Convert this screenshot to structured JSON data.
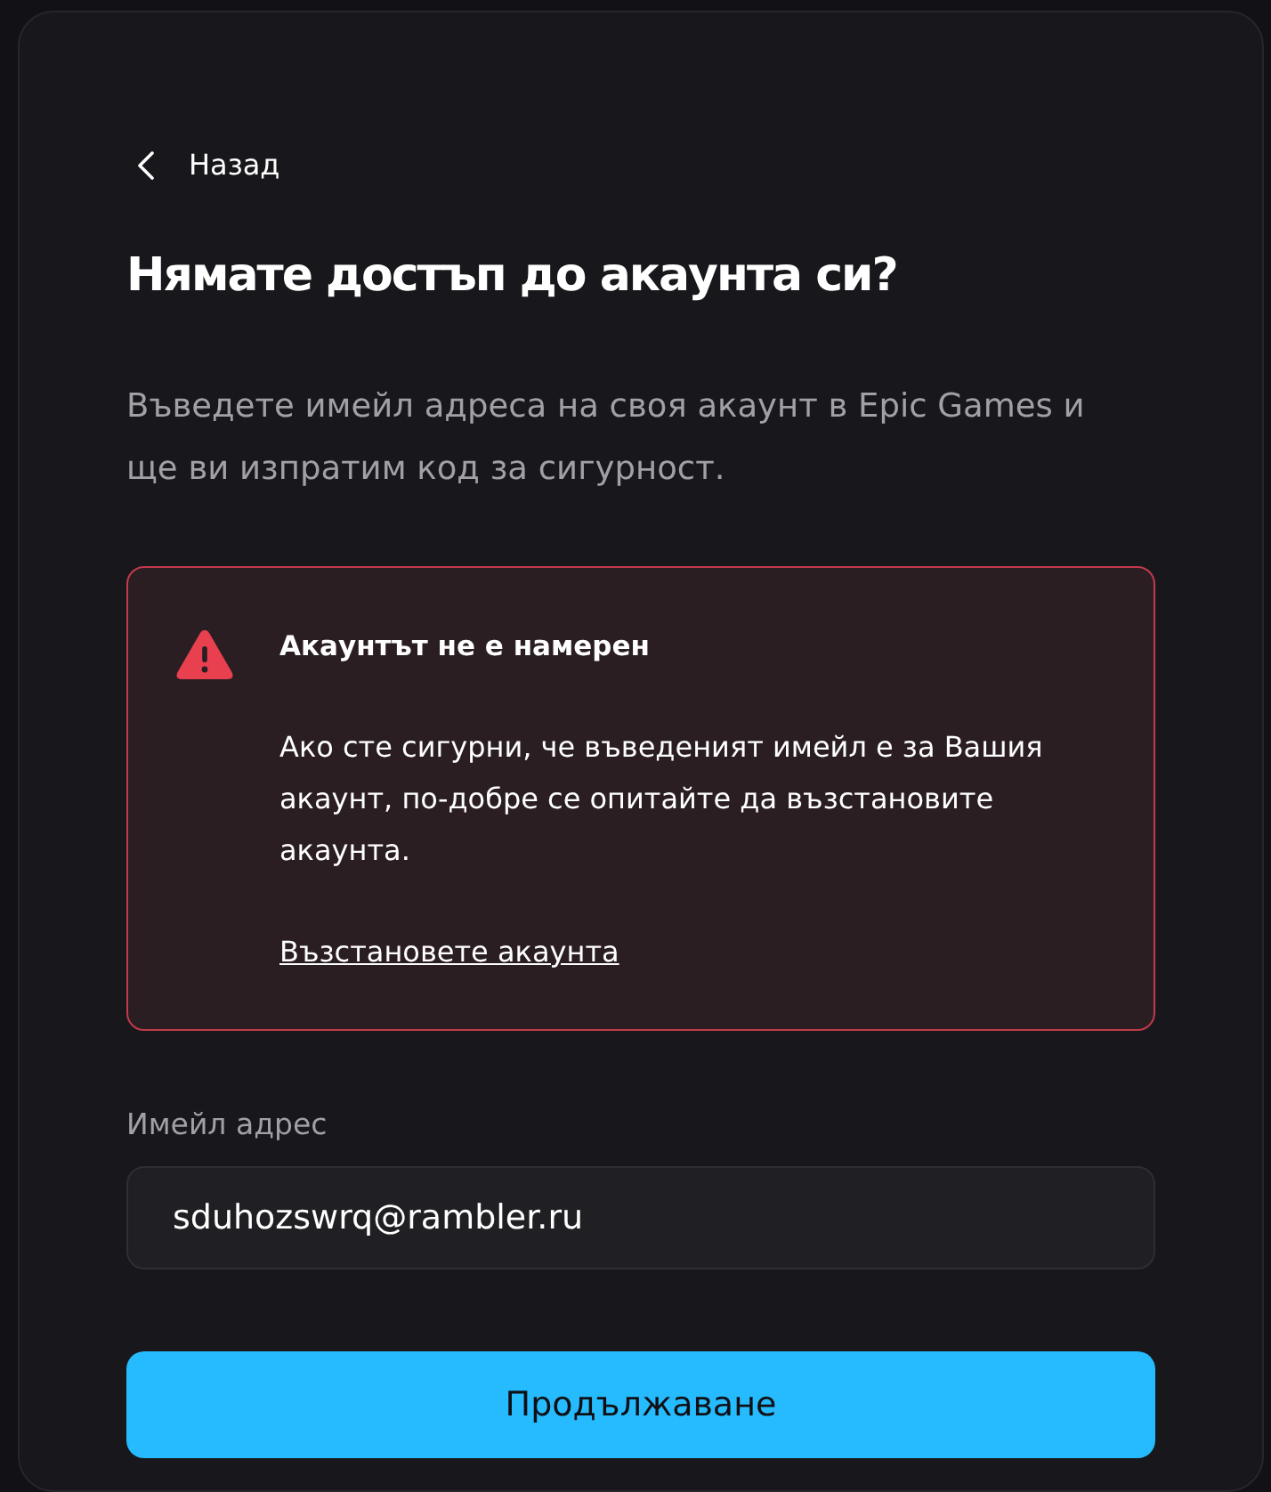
{
  "back_link": {
    "label": "Назад"
  },
  "title": "Нямате достъп до акаунта си?",
  "description": "Въведете имейл адреса на своя акаунт в Epic Games и ще ви изпратим код за сигурност.",
  "alert": {
    "kind": "error",
    "title": "Акаунтът не е намерен",
    "message": "Ако сте сигурни, че въведеният имейл е за Вашия акаунт, по-добре се опитайте да възстановите акаунта.",
    "link": "Възстановете акаунта"
  },
  "email_field": {
    "label": "Имейл адрес",
    "value": "sduhozswrq@rambler.ru"
  },
  "buttons": [
    {
      "kind": "primary",
      "label": "Продължаване"
    }
  ]
}
